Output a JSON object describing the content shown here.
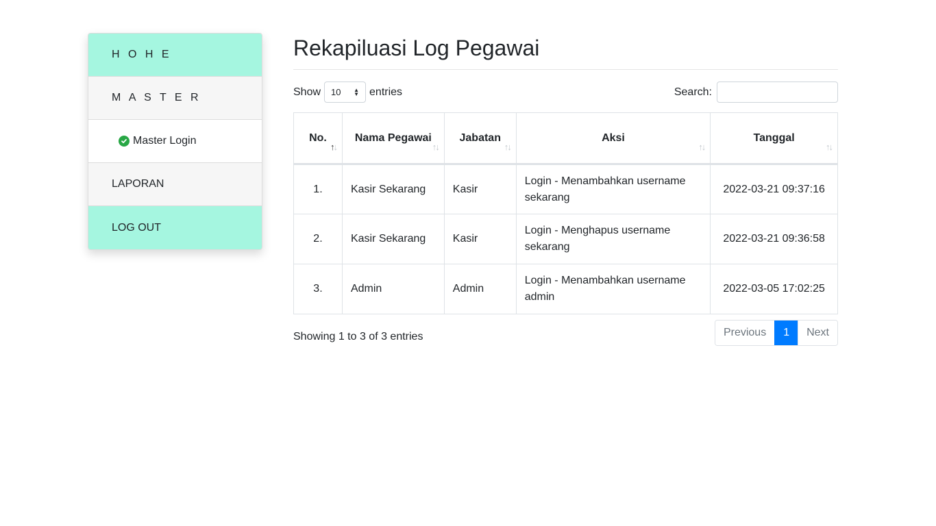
{
  "sidebar": {
    "items": [
      {
        "label": "H O H E"
      },
      {
        "label": "M A S T E R"
      },
      {
        "label": "Master Login"
      },
      {
        "label": "LAPORAN"
      },
      {
        "label": "LOG OUT"
      }
    ]
  },
  "page": {
    "title": "Rekapiluasi Log Pegawai"
  },
  "controls": {
    "show_label": "Show",
    "entries_value": "10",
    "entries_label": "entries",
    "search_label": "Search:",
    "search_value": ""
  },
  "table": {
    "columns": [
      "No.",
      "Nama Pegawai",
      "Jabatan",
      "Aksi",
      "Tanggal"
    ],
    "rows": [
      {
        "no": "1.",
        "nama": "Kasir Sekarang",
        "jabatan": "Kasir",
        "aksi": "Login - Menambahkan username sekarang",
        "tanggal": "2022-03-21 09:37:16"
      },
      {
        "no": "2.",
        "nama": "Kasir Sekarang",
        "jabatan": "Kasir",
        "aksi": "Login - Menghapus username sekarang",
        "tanggal": "2022-03-21 09:36:58"
      },
      {
        "no": "3.",
        "nama": "Admin",
        "jabatan": "Admin",
        "aksi": "Login - Menambahkan username admin",
        "tanggal": "2022-03-05 17:02:25"
      }
    ]
  },
  "footer": {
    "info": "Showing 1 to 3 of 3 entries",
    "previous": "Previous",
    "current_page": "1",
    "next": "Next"
  },
  "colors": {
    "accent_mint": "#a5f6e0",
    "primary": "#007bff",
    "success": "#28a745"
  }
}
